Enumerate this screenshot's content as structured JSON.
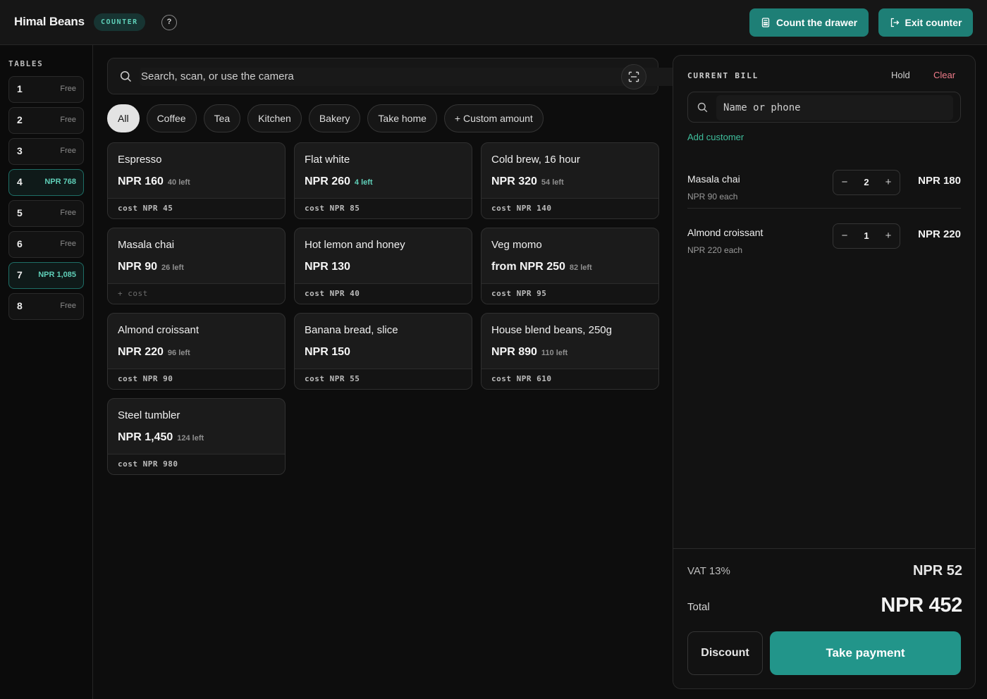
{
  "header": {
    "brand": "Himal Beans",
    "mode_badge": "COUNTER",
    "help_label": "?",
    "count_drawer_label": "Count the drawer",
    "exit_counter_label": "Exit counter"
  },
  "sidebar": {
    "title": "TABLES",
    "tables": [
      {
        "number": "1",
        "status": "Free",
        "busy": false
      },
      {
        "number": "2",
        "status": "Free",
        "busy": false
      },
      {
        "number": "3",
        "status": "Free",
        "busy": false
      },
      {
        "number": "4",
        "status": "NPR 768",
        "busy": true
      },
      {
        "number": "5",
        "status": "Free",
        "busy": false
      },
      {
        "number": "6",
        "status": "Free",
        "busy": false
      },
      {
        "number": "7",
        "status": "NPR 1,085",
        "busy": true
      },
      {
        "number": "8",
        "status": "Free",
        "busy": false
      }
    ]
  },
  "search": {
    "placeholder": "Search, scan, or use the camera"
  },
  "categories": [
    "All",
    "Coffee",
    "Tea",
    "Kitchen",
    "Bakery",
    "Take home",
    "+ Custom amount"
  ],
  "products": [
    {
      "name": "Espresso",
      "price": "NPR 160",
      "stock": "40 left",
      "low": false,
      "cost": "cost NPR 45"
    },
    {
      "name": "Flat white",
      "price": "NPR 260",
      "stock": "4 left",
      "low": true,
      "cost": "cost NPR 85"
    },
    {
      "name": "Cold brew, 16 hour",
      "price": "NPR 320",
      "stock": "54 left",
      "low": false,
      "cost": "cost NPR 140"
    },
    {
      "name": "Masala chai",
      "price": "NPR 90",
      "stock": "26 left",
      "low": false,
      "cost": "+ cost"
    },
    {
      "name": "Hot lemon and honey",
      "price": "NPR 130",
      "stock": "",
      "low": false,
      "cost": "cost NPR 40"
    },
    {
      "name": "Veg momo",
      "price": "from NPR 250",
      "stock": "82 left",
      "low": false,
      "cost": "cost NPR 95"
    },
    {
      "name": "Almond croissant",
      "price": "NPR 220",
      "stock": "96 left",
      "low": false,
      "cost": "cost NPR 90"
    },
    {
      "name": "Banana bread, slice",
      "price": "NPR 150",
      "stock": "",
      "low": false,
      "cost": "cost NPR 55"
    },
    {
      "name": "House blend beans, 250g",
      "price": "NPR 890",
      "stock": "110 left",
      "low": false,
      "cost": "cost NPR 610"
    },
    {
      "name": "Steel tumbler",
      "price": "NPR 1,450",
      "stock": "124 left",
      "low": false,
      "cost": "cost NPR 980"
    }
  ],
  "bill": {
    "title": "CURRENT BILL",
    "hold_label": "Hold",
    "clear_label": "Clear",
    "customer_placeholder": "Name or phone",
    "add_customer_label": "Add customer",
    "lines": [
      {
        "name": "Masala chai",
        "each": "NPR 90 each",
        "qty": "2",
        "total": "NPR 180"
      },
      {
        "name": "Almond croissant",
        "each": "NPR 220 each",
        "qty": "1",
        "total": "NPR 220"
      }
    ],
    "stepper_minus": "−",
    "stepper_plus": "+",
    "vat_label": "VAT 13%",
    "vat_value": "NPR 52",
    "total_label": "Total",
    "total_value": "NPR 452",
    "discount_label": "Discount",
    "pay_label": "Take payment"
  },
  "colors": {
    "accent": "#1e7f76",
    "accent_text": "#5fcfb8",
    "danger_text": "#f07c8a"
  }
}
